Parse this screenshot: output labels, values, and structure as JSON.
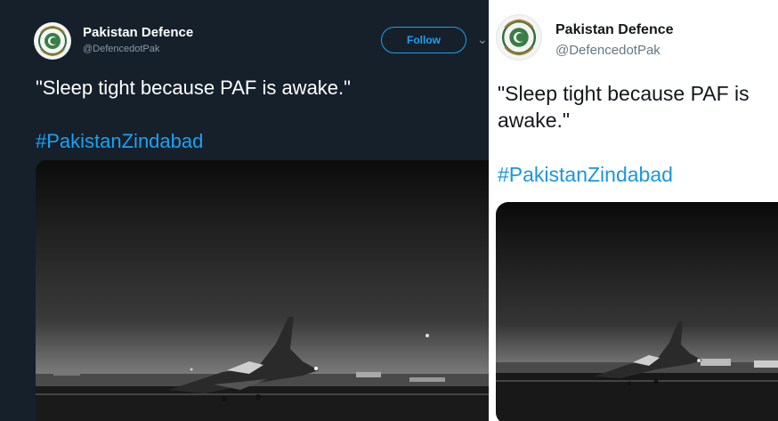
{
  "left_tweet": {
    "display_name": "Pakistan Defence",
    "handle": "@DefencedotPak",
    "follow_label": "Follow",
    "text": "\"Sleep tight because PAF is awake.\"",
    "hashtag": "#PakistanZindabad",
    "theme": "dark",
    "colors": {
      "background": "#15202b",
      "accent": "#1da1f2",
      "muted": "#8899a6"
    },
    "icons": [
      "emblem-avatar",
      "chevron-down-icon"
    ],
    "media": {
      "alt_subject": "fighter jet on night runway"
    }
  },
  "right_tweet": {
    "display_name": "Pakistan Defence",
    "handle": "@DefencedotPak",
    "text": "\"Sleep tight because PAF is awake.\"",
    "hashtag": "#PakistanZindabad",
    "theme": "light",
    "colors": {
      "background": "#ffffff",
      "accent": "#1b95e0",
      "muted": "#657786"
    },
    "icons": [
      "emblem-avatar"
    ]
  }
}
